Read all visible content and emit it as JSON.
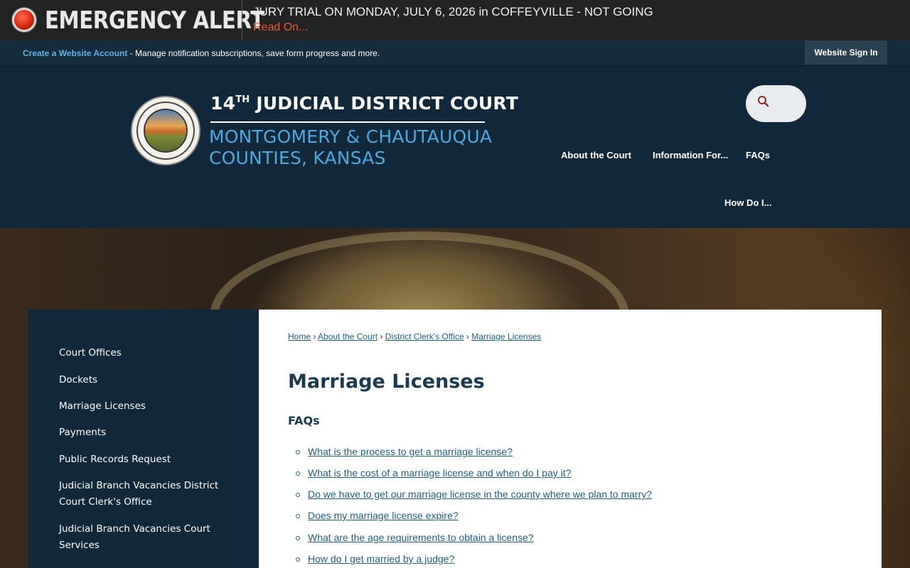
{
  "alert": {
    "title": "EMERGENCY ALERT",
    "message": "JURY TRIAL ON MONDAY, JULY 6, 2026 in COFFEYVILLE - NOT GOING",
    "read_on": "Read On..."
  },
  "account_bar": {
    "create_link": "Create a Website Account",
    "description": " - Manage notification subscriptions, save form progress and more.",
    "sign_in": "Website Sign In"
  },
  "logo": {
    "line1_number": "14",
    "line1_sup": "TH",
    "line1_text": " JUDICIAL DISTRICT COURT",
    "line2": "MONTGOMERY & CHAUTAUQUA",
    "line3": "COUNTIES, KANSAS"
  },
  "nav": {
    "about": "About the Court",
    "info": "Information For...",
    "faqs": "FAQs",
    "howdo": "How Do I..."
  },
  "sidebar": {
    "items": [
      "Court Offices",
      "Dockets",
      "Marriage Licenses",
      "Payments",
      "Public Records Request",
      "Judicial Branch Vacancies District Court Clerk's Office",
      "Judicial Branch Vacancies Court Services"
    ]
  },
  "breadcrumb": {
    "home": "Home",
    "about": "About the Court",
    "clerk": "District Clerk's Office",
    "current": "Marriage Licenses",
    "sep": "›"
  },
  "main": {
    "title": "Marriage Licenses",
    "faq_heading": "FAQs",
    "faqs": [
      "What is the process to get a marriage license?",
      "What is the cost of a marriage license and when do I pay it?",
      "Do we have to get our marriage license in the county where we plan to marry?",
      "Does my marriage license expire?",
      "What are the age requirements to obtain a license?",
      "How do I get married by a judge?"
    ]
  },
  "colors": {
    "header_bg": "#11283a",
    "alert_red": "#e8573a",
    "link_blue": "#1f5f87",
    "title_blue": "#1a3a52",
    "logo_blue": "#4fa8df"
  }
}
